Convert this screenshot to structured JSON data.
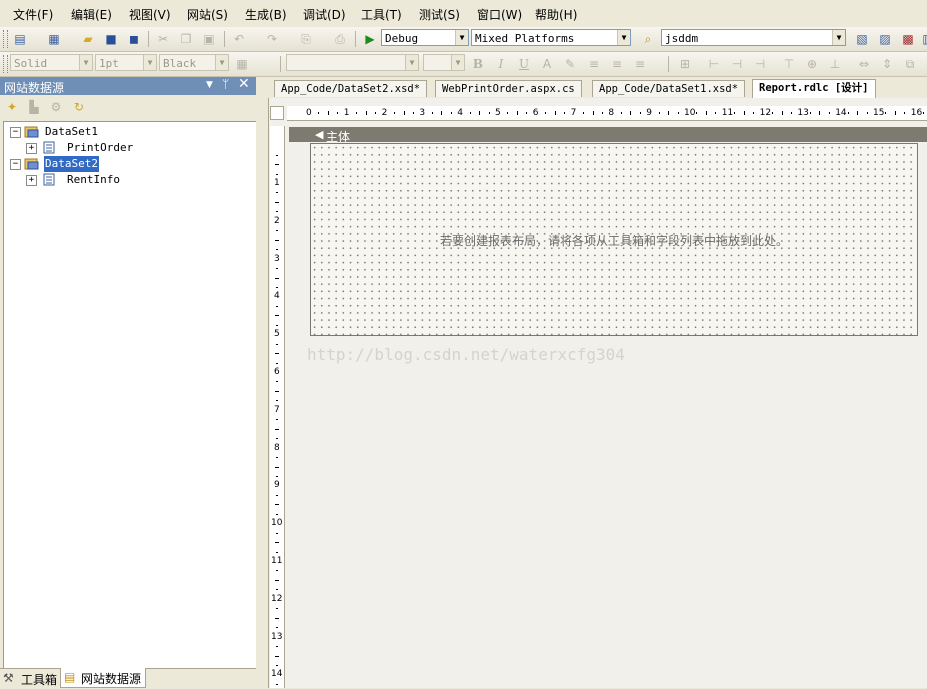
{
  "menu": [
    "文件(F)",
    "编辑(E)",
    "视图(V)",
    "网站(S)",
    "生成(B)",
    "调试(D)",
    "工具(T)",
    "测试(S)",
    "窗口(W)",
    "帮助(H)"
  ],
  "toolbar1": {
    "config": "Debug",
    "platform": "Mixed Platforms",
    "find": "jsddm"
  },
  "toolbar2": {
    "border_style": "Solid",
    "border_width": "1pt",
    "border_color": "Black",
    "bold": "B",
    "italic": "I",
    "underline": "U",
    "font_color": "A"
  },
  "datasource_panel": {
    "title": "网站数据源",
    "tree": [
      {
        "label": "DataSet1",
        "children": [
          "PrintOrder"
        ]
      },
      {
        "label": "DataSet2",
        "children": [
          "RentInfo"
        ],
        "selected": true
      }
    ]
  },
  "bottom_tabs": [
    "工具箱",
    "网站数据源"
  ],
  "doc_tabs": [
    {
      "label": "App_Code/DataSet2.xsd*",
      "active": false
    },
    {
      "label": "WebPrintOrder.aspx.cs",
      "active": false
    },
    {
      "label": "App_Code/DataSet1.xsd*",
      "active": false
    },
    {
      "label": "Report.rdlc [设计]",
      "active": true
    }
  ],
  "designer": {
    "band_title": "主体",
    "hint": "若要创建报表布局，请将各项从工具箱和字段列表中拖放到此处。",
    "watermark": "http://blog.csdn.net/waterxcfg304",
    "hruler_labels": [
      "0",
      "1",
      "2",
      "3",
      "4",
      "5",
      "6",
      "7",
      "8",
      "9",
      "10",
      "11",
      "12",
      "13",
      "14",
      "15",
      "16"
    ],
    "vruler_labels": [
      "1",
      "2",
      "3",
      "4",
      "5",
      "6",
      "7",
      "8",
      "9",
      "10",
      "11",
      "12",
      "13",
      "14"
    ]
  },
  "colors": {
    "chrome": "#ece9d8",
    "panel_title": "#6f8fb6",
    "selected": "#316ac5",
    "band": "#7d7b70"
  }
}
